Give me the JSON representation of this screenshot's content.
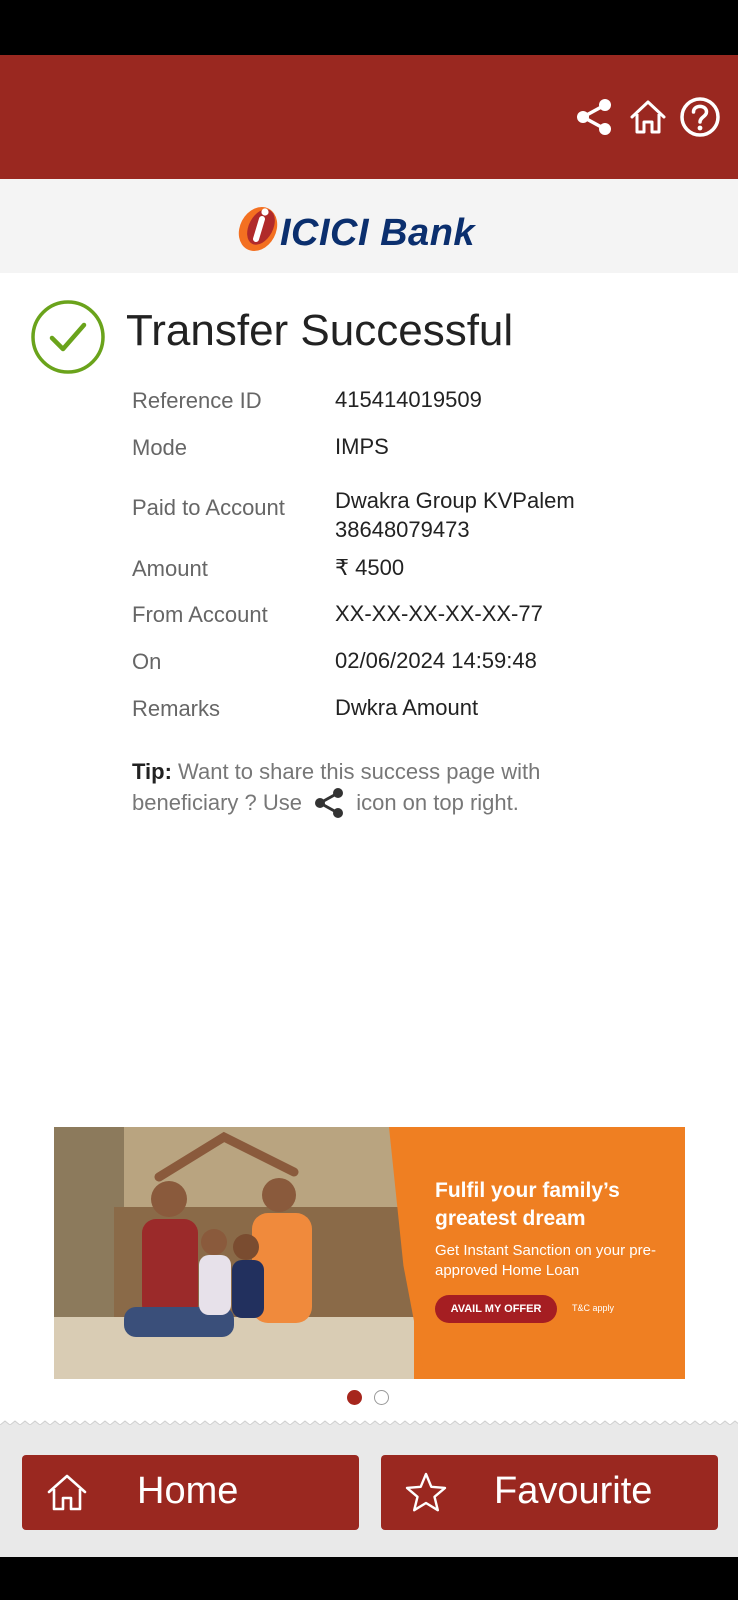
{
  "header": {
    "share_icon": "share-icon",
    "home_icon": "home-icon",
    "help_icon": "help-icon",
    "brand_color": "#9a2820"
  },
  "logo": {
    "text": "ICICI Bank",
    "color": "#0b2f6e"
  },
  "result": {
    "title": "Transfer Successful",
    "status_icon": "check-circle-icon",
    "status_color": "#6aa31b"
  },
  "details": [
    {
      "label": "Reference ID",
      "value": "415414019509"
    },
    {
      "label": "Mode",
      "value": "IMPS"
    },
    {
      "label": "Paid to Account",
      "value": "Dwakra Group KVPalem",
      "value2": "38648079473"
    },
    {
      "label": "Amount",
      "value": "₹ 4500"
    },
    {
      "label": "From Account",
      "value": "XX-XX-XX-XX-XX-77"
    },
    {
      "label": "On",
      "value": "02/06/2024 14:59:48"
    },
    {
      "label": "Remarks",
      "value": "Dwkra Amount"
    }
  ],
  "tip": {
    "label": "Tip:",
    "text_before": " Want to share this success page with beneficiary ? Use ",
    "text_after": " icon on top right."
  },
  "banner": {
    "headline": "Fulfil your family’s greatest dream",
    "subtext": "Get Instant Sanction on your pre-approved Home Loan",
    "cta": "AVAIL MY OFFER",
    "tnc": "T&C apply",
    "carousel_index": 1,
    "carousel_total": 2
  },
  "bottom_nav": {
    "home_label": "Home",
    "favourite_label": "Favourite"
  }
}
